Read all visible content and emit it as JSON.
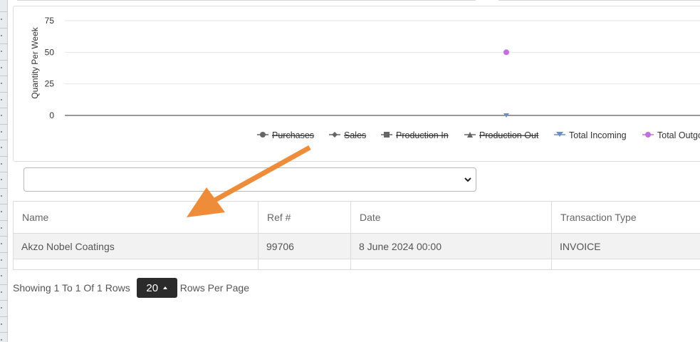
{
  "chart_data": {
    "type": "line",
    "ylabel": "Quantity Per Week",
    "y_ticks": [
      0,
      25,
      50,
      75
    ],
    "ylim": [
      0,
      75
    ],
    "grid": true,
    "legend_placement": "bottom",
    "series": [
      {
        "name": "Purchases",
        "marker": "circle",
        "color": "#666666",
        "hidden": true
      },
      {
        "name": "Sales",
        "marker": "diamond",
        "color": "#666666",
        "hidden": true
      },
      {
        "name": "Production In",
        "marker": "square",
        "color": "#666666",
        "hidden": true
      },
      {
        "name": "Production Out",
        "marker": "triangle",
        "color": "#666666",
        "hidden": true
      },
      {
        "name": "Total Incoming",
        "marker": "triangle-down",
        "color": "#6a8fc0",
        "hidden": false,
        "values": [
          0
        ]
      },
      {
        "name": "Total Outgoing",
        "legend_label": "Total Outgo",
        "marker": "circle",
        "color": "#c46fe0",
        "hidden": false,
        "values": [
          50
        ]
      }
    ]
  },
  "filter": {
    "value": ""
  },
  "table": {
    "headers": [
      "Name",
      "Ref #",
      "Date",
      "Transaction Type"
    ],
    "rows": [
      [
        "Akzo Nobel Coatings",
        "99706",
        "8 June 2024 00:00",
        "INVOICE"
      ]
    ]
  },
  "pagination": {
    "showing_text": "Showing 1 To 1 Of 1 Rows",
    "page_size": "20",
    "per_page_text": "Rows Per Page"
  },
  "colors": {
    "annotation_arrow": "#ee8c3a",
    "page_size_button": "#2b2b2b"
  }
}
